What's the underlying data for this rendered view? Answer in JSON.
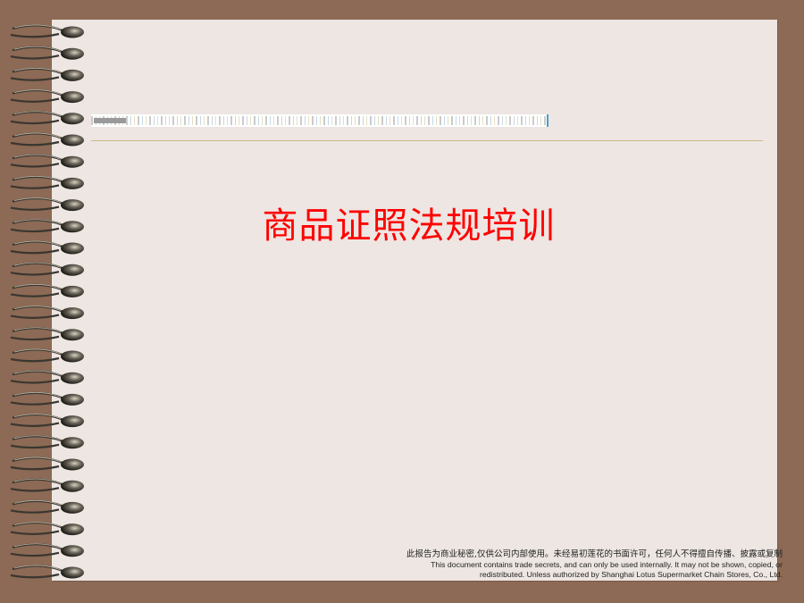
{
  "slide": {
    "title": "商品证照法规培训",
    "footer": {
      "line_cn": "此报告为商业秘密,仅供公司内部使用。未经易初莲花的书面许可，任何人不得擅自传播、披露或复制",
      "line_en_1": "This document contains trade secrets, and can only be used internally. It may not be shown, copied, or",
      "line_en_2": "redistributed. Unless authorized by Shanghai Lotus Supermarket Chain Stores, Co., Ltd."
    }
  },
  "colors": {
    "background": "#8c6a55",
    "page": "#ede6e2",
    "title": "#ff0000",
    "rule": "#c9b98a"
  },
  "icons": {
    "binding": "spiral-binding-icon"
  }
}
